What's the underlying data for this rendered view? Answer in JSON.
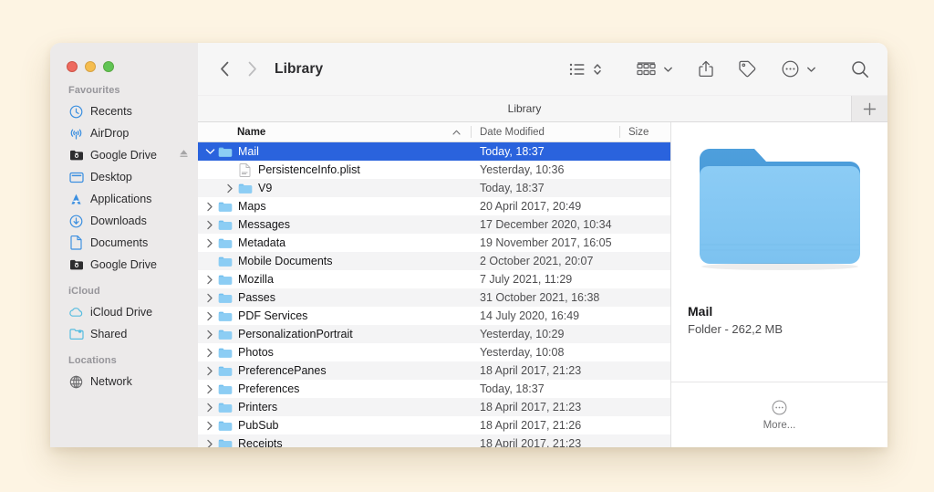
{
  "window": {
    "title": "Library",
    "traffic_lights": [
      "close-red",
      "minimize-yellow",
      "zoom-green"
    ],
    "colors": {
      "accent": "#2a63dd",
      "background": "#fdf4e3",
      "sidebar": "#eceaea"
    }
  },
  "toolbar": {
    "back_label": "‹",
    "forward_label": "›",
    "title": "Library",
    "view_icon": "list-view-icon",
    "view_chevron": "up-down-chevron-icon",
    "group_icon": "group-by-icon",
    "group_chevron": "chevron-down-icon",
    "share_icon": "share-icon",
    "tag_icon": "tag-icon",
    "more_icon": "ellipsis-circle-icon",
    "more_chevron": "chevron-down-icon",
    "search_icon": "search-icon"
  },
  "tabbar": {
    "active_tab": "Library",
    "add_label": "+"
  },
  "sidebar": {
    "sections": [
      {
        "title": "Favourites",
        "items": [
          {
            "label": "Recents",
            "icon": "clock-icon"
          },
          {
            "label": "AirDrop",
            "icon": "airdrop-icon"
          },
          {
            "label": "Google Drive",
            "icon": "google-drive-folder-icon",
            "eject": true
          },
          {
            "label": "Desktop",
            "icon": "desktop-icon"
          },
          {
            "label": "Applications",
            "icon": "applications-icon"
          },
          {
            "label": "Downloads",
            "icon": "downloads-icon"
          },
          {
            "label": "Documents",
            "icon": "document-icon"
          },
          {
            "label": "Google Drive",
            "icon": "google-drive-folder-icon"
          }
        ]
      },
      {
        "title": "iCloud",
        "items": [
          {
            "label": "iCloud Drive",
            "icon": "cloud-icon"
          },
          {
            "label": "Shared",
            "icon": "shared-folder-icon"
          }
        ]
      },
      {
        "title": "Locations",
        "items": [
          {
            "label": "Network",
            "icon": "globe-icon"
          }
        ]
      }
    ]
  },
  "filelist": {
    "columns": {
      "name": "Name",
      "date_modified": "Date Modified",
      "size": "Size"
    },
    "sort_indicator": "ascending-arrow-icon",
    "rows": [
      {
        "name": "Mail",
        "date": "Today, 18:37",
        "size": "",
        "depth": 0,
        "disclosure": "expanded",
        "icon": "folder-icon",
        "selected": true
      },
      {
        "name": "PersistenceInfo.plist",
        "date": "Yesterday, 10:36",
        "size": "",
        "depth": 1,
        "disclosure": "none",
        "icon": "plist-file-icon",
        "selected": false
      },
      {
        "name": "V9",
        "date": "Today, 18:37",
        "size": "",
        "depth": 1,
        "disclosure": "collapsed",
        "icon": "folder-icon",
        "selected": false
      },
      {
        "name": "Maps",
        "date": "20 April 2017, 20:49",
        "size": "",
        "depth": 0,
        "disclosure": "collapsed",
        "icon": "folder-icon",
        "selected": false
      },
      {
        "name": "Messages",
        "date": "17 December 2020, 10:34",
        "size": "",
        "depth": 0,
        "disclosure": "collapsed",
        "icon": "folder-icon",
        "selected": false
      },
      {
        "name": "Metadata",
        "date": "19 November 2017, 16:05",
        "size": "",
        "depth": 0,
        "disclosure": "collapsed",
        "icon": "folder-icon",
        "selected": false
      },
      {
        "name": "Mobile Documents",
        "date": "2 October 2021, 20:07",
        "size": "",
        "depth": 0,
        "disclosure": "none",
        "icon": "folder-icon",
        "selected": false
      },
      {
        "name": "Mozilla",
        "date": "7 July 2021, 11:29",
        "size": "",
        "depth": 0,
        "disclosure": "collapsed",
        "icon": "folder-icon",
        "selected": false
      },
      {
        "name": "Passes",
        "date": "31 October 2021, 16:38",
        "size": "",
        "depth": 0,
        "disclosure": "collapsed",
        "icon": "folder-icon",
        "selected": false
      },
      {
        "name": "PDF Services",
        "date": "14 July 2020, 16:49",
        "size": "",
        "depth": 0,
        "disclosure": "collapsed",
        "icon": "folder-icon",
        "selected": false
      },
      {
        "name": "PersonalizationPortrait",
        "date": "Yesterday, 10:29",
        "size": "",
        "depth": 0,
        "disclosure": "collapsed",
        "icon": "folder-icon",
        "selected": false
      },
      {
        "name": "Photos",
        "date": "Yesterday, 10:08",
        "size": "",
        "depth": 0,
        "disclosure": "collapsed",
        "icon": "folder-icon",
        "selected": false
      },
      {
        "name": "PreferencePanes",
        "date": "18 April 2017, 21:23",
        "size": "",
        "depth": 0,
        "disclosure": "collapsed",
        "icon": "folder-icon",
        "selected": false
      },
      {
        "name": "Preferences",
        "date": "Today, 18:37",
        "size": "",
        "depth": 0,
        "disclosure": "collapsed",
        "icon": "folder-icon",
        "selected": false
      },
      {
        "name": "Printers",
        "date": "18 April 2017, 21:23",
        "size": "",
        "depth": 0,
        "disclosure": "collapsed",
        "icon": "folder-icon",
        "selected": false
      },
      {
        "name": "PubSub",
        "date": "18 April 2017, 21:26",
        "size": "",
        "depth": 0,
        "disclosure": "collapsed",
        "icon": "folder-icon",
        "selected": false
      },
      {
        "name": "Receipts",
        "date": "18 April 2017, 21:23",
        "size": "",
        "depth": 0,
        "disclosure": "collapsed",
        "icon": "folder-icon",
        "selected": false
      }
    ]
  },
  "preview": {
    "icon": "large-folder-icon",
    "name": "Mail",
    "kind_and_size": "Folder - 262,2 MB",
    "more_icon": "ellipsis-circle-icon",
    "more_label": "More..."
  }
}
